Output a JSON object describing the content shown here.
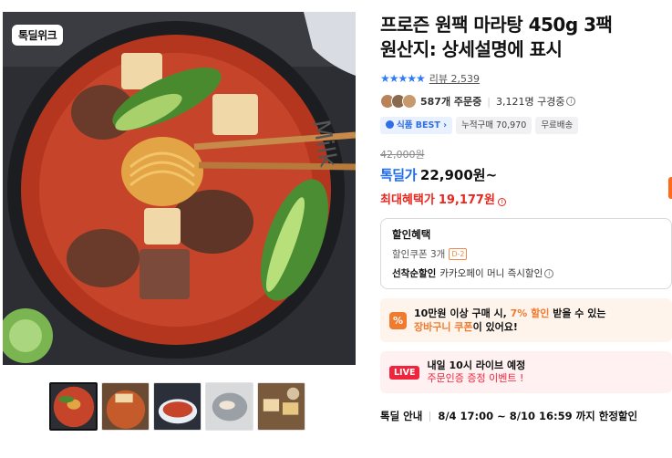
{
  "image": {
    "brand_badge": "톡딜위크",
    "thumbnails": [
      "thumb-1",
      "thumb-2",
      "thumb-3",
      "thumb-4",
      "thumb-5"
    ],
    "selected_thumbnail": 0
  },
  "product": {
    "title_line1": "프로즌 원팩 마라탕 450g 3팩",
    "title_line2": "원산지: 상세설명에 표시",
    "stars": "★★★★★",
    "review_label": "리뷰 2,539",
    "orders": "587개 주문중",
    "subscribers": "3,121명 구경중",
    "chip_best": "식품 BEST",
    "chip_cumulative": "누적구매 70,970",
    "chip_shipping": "무료배송",
    "original_price": "42,000원",
    "price_label": "톡딜가",
    "price_value": "22,900원~",
    "max_benefit_label": "최대혜택가",
    "max_benefit_value": "19,177원"
  },
  "discount": {
    "title": "할인혜택",
    "coupon_label": "할인쿠폰 3개",
    "coupon_tag": "D-2",
    "instant_label": "선착순할인",
    "instant_value": "카카오페이 머니 즉시할인"
  },
  "cart_coupon": {
    "icon": "%",
    "line1_a": "10만원 이상 구매 시, ",
    "line1_b": "7% 할인",
    "line1_c": " 받을 수 있는",
    "line2_a": "장바구니 쿠폰",
    "line2_b": "이 있어요!"
  },
  "live": {
    "badge": "LIVE",
    "line1": "내일 10시 라이브 예정",
    "line2": "주문인증 증정 이벤트 !"
  },
  "deal": {
    "label": "톡딜 안내",
    "period": "8/4 17:00 ~ 8/10 16:59 까지 한정할인"
  },
  "colors": {
    "accent_blue": "#1f6cf0",
    "accent_red": "#e8281f",
    "accent_orange": "#f07b2f"
  }
}
